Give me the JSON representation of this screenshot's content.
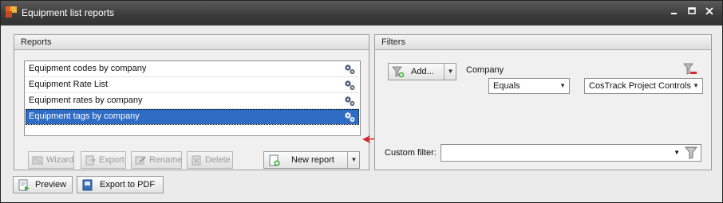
{
  "window": {
    "title": "Equipment list reports",
    "controls": [
      "minimize",
      "maximize",
      "close"
    ]
  },
  "reports": {
    "header": "Reports",
    "items": [
      {
        "label": "Equipment codes by company",
        "selected": false
      },
      {
        "label": "Equipment Rate List",
        "selected": false
      },
      {
        "label": "Equipment rates by company",
        "selected": false
      },
      {
        "label": "Equipment tags by company",
        "selected": true
      }
    ],
    "toolbar": {
      "wizard": "Wizard",
      "export": "Export",
      "rename": "Rename",
      "delete": "Delete",
      "new_report": "New report"
    }
  },
  "filters": {
    "header": "Filters",
    "add_label": "Add...",
    "company_label": "Company",
    "operator_value": "Equals",
    "company_value": "CosTrack Project Controls",
    "custom_filter_label": "Custom filter:",
    "custom_filter_value": ""
  },
  "bottom": {
    "preview": "Preview",
    "export_pdf": "Export to PDF"
  },
  "colors": {
    "selection": "#2f6cc4",
    "titlebar": "#3a3a3a",
    "annotation_arrow": "#d42a2a"
  }
}
